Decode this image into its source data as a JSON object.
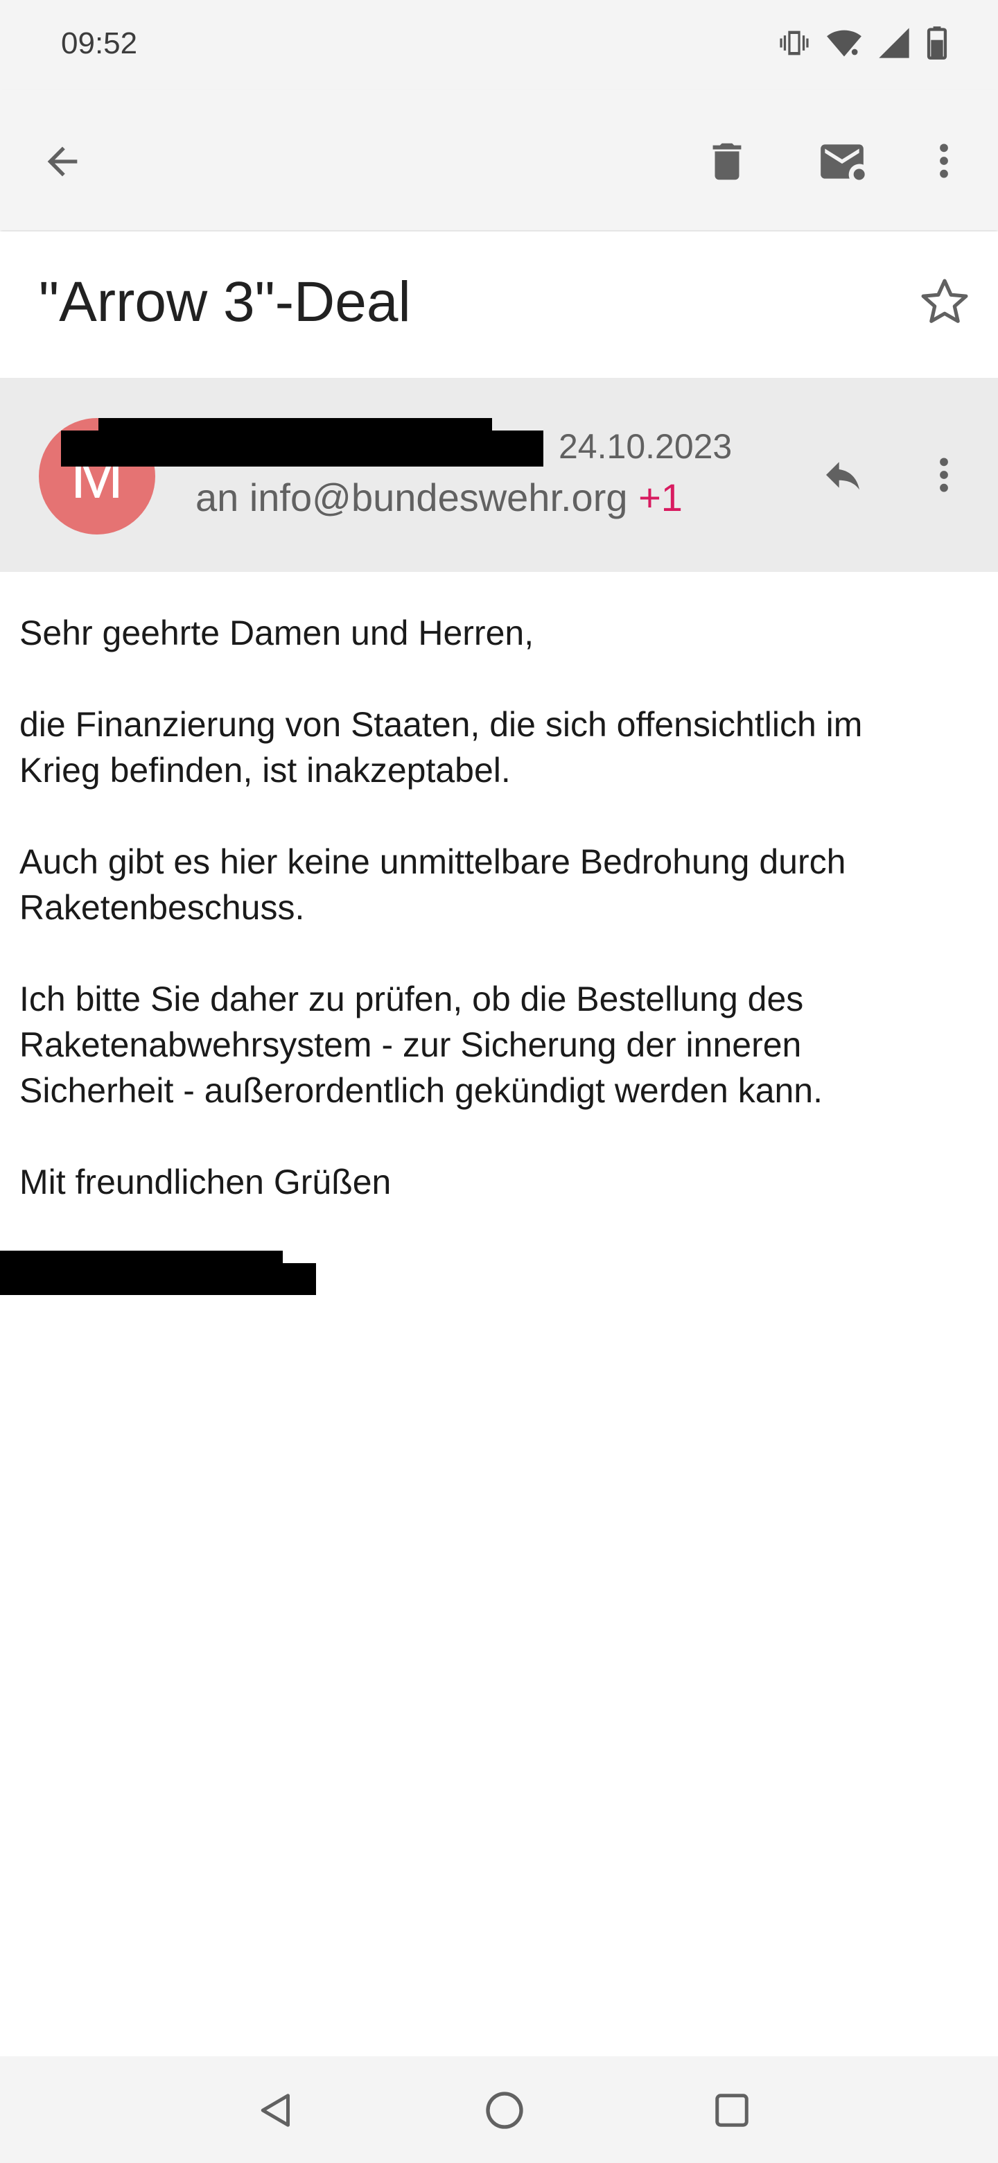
{
  "status_bar": {
    "time": "09:52",
    "icons": [
      "vibrate-icon",
      "wifi-icon",
      "cell-signal-icon",
      "battery-icon"
    ]
  },
  "toolbar": {
    "icons": [
      "back-arrow-icon",
      "delete-icon",
      "mark-unread-icon",
      "more-vert-icon"
    ]
  },
  "email": {
    "subject": "\"Arrow 3\"-Deal",
    "avatar_initial": "M",
    "date": "24.10.2023",
    "recipient_prefix": "an info@bundeswehr.org ",
    "recipient_extra": "+1",
    "body": [
      "Sehr geehrte Damen und Herren,",
      "die Finanzierung von Staaten, die sich offensichtlich im\nKrieg befinden, ist inakzeptabel.",
      "Auch gibt es hier keine unmittelbare Bedrohung durch\nRaketenbeschuss.",
      "Ich bitte Sie daher zu prüfen, ob die Bestellung des\nRaketenabwehrsystem - zur Sicherung der inneren\nSicherheit - außerordentlich gekündigt werden kann.",
      "Mit freundlichen Grüßen"
    ]
  },
  "nav_bar": {
    "icons": [
      "back-triangle-icon",
      "home-circle-icon",
      "recents-square-icon"
    ]
  },
  "colors": {
    "bar_bg": "#f4f4f4",
    "sender_bg": "#ebebeb",
    "avatar": "#e57373",
    "accent": "#d81b60",
    "icon": "#616161"
  }
}
